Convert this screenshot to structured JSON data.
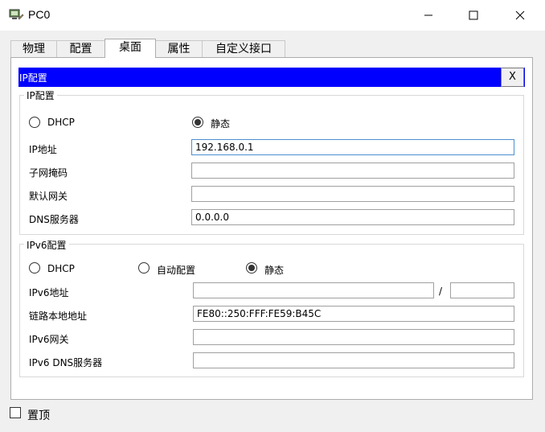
{
  "window": {
    "title": "PC0",
    "icon": "pc-app-icon",
    "controls": [
      "minimize-icon",
      "maximize-icon",
      "close-icon"
    ]
  },
  "tabs": [
    {
      "label": "物理"
    },
    {
      "label": "配置"
    },
    {
      "label": "桌面",
      "active": true
    },
    {
      "label": "属性"
    },
    {
      "label": "自定义接口"
    }
  ],
  "dialog": {
    "title": "IP配置",
    "close_label": "X",
    "accent_color": "#0000ff"
  },
  "ipv4": {
    "section_title": "IP配置",
    "dhcp_label": "DHCP",
    "static_label": "静态",
    "selected_mode": "静态",
    "ip_label": "IP地址",
    "ip_value": "192.168.0.1",
    "mask_label": "子网掩码",
    "mask_value": "",
    "gateway_label": "默认网关",
    "gateway_value": "",
    "dns_label": "DNS服务器",
    "dns_value": "0.0.0.0"
  },
  "ipv6": {
    "section_title": "IPv6配置",
    "dhcp_label": "DHCP",
    "auto_label": "自动配置",
    "static_label": "静态",
    "selected_mode": "静态",
    "addr_label": "IPv6地址",
    "addr_value": "",
    "slash": "/",
    "prefix_value": "",
    "link_local_label": "链路本地地址",
    "link_local_value": "FE80::250:FFF:FE59:B45C",
    "gateway_label": "IPv6网关",
    "gateway_value": "",
    "dns_label": "IPv6 DNS服务器",
    "dns_value": ""
  },
  "footer": {
    "top_label": "置顶",
    "top_checked": false
  }
}
